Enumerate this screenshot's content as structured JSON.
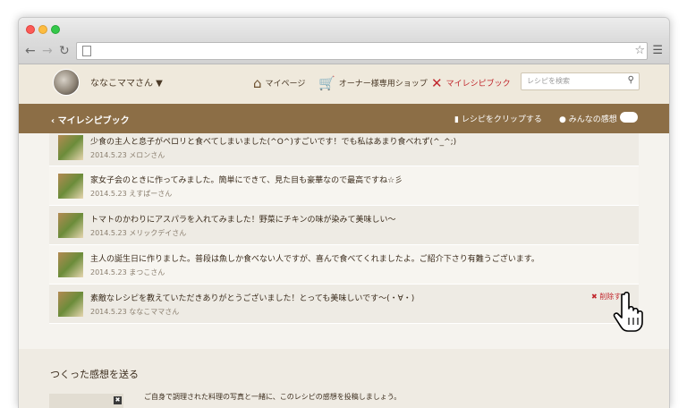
{
  "browser": {
    "nav_back": "←",
    "nav_forward": "→",
    "reload": "↻",
    "star": "☆",
    "menu": "☰"
  },
  "header": {
    "username": "ななこママさん ▼",
    "nav": [
      {
        "label": "マイページ",
        "icon": "house-icon"
      },
      {
        "label": "オーナー様専用ショップ",
        "icon": "cart-icon"
      },
      {
        "label": "マイレシピブック",
        "icon": "fork-knife-icon"
      }
    ],
    "search_placeholder": "レシピを検索",
    "accent_color": "#c1272d"
  },
  "subbar": {
    "back_label": "マイレシピブック",
    "clip_label": "レシピをクリップする",
    "kansou_label": "みんなの感想",
    "bg_color": "#8c6e46"
  },
  "comments": [
    {
      "text": "少食の主人と息子がペロリと食べてしまいました(^O^)すごいです！でも私はあまり食べれず(^_^;)",
      "meta": "2014.5.23 メロンさん"
    },
    {
      "text": "家女子会のときに作ってみました。簡単にできて、見た目も豪華なので最高ですね☆彡",
      "meta": "2014.5.23 えすぱーさん"
    },
    {
      "text": "トマトのかわりにアスパラを入れてみました！野菜にチキンの味が染みて美味しい〜",
      "meta": "2014.5.23 メリックデイさん"
    },
    {
      "text": "主人の誕生日に作りました。普段は魚しか食べない人ですが、喜んで食べてくれましたよ。ご紹介下さり有難うございます。",
      "meta": "2014.5.23 まつこさん"
    },
    {
      "text": "素敵なレシピを教えていただきありがとうございました！とっても美味しいです〜(・∀・)",
      "meta": "2014.5.23 ななこママさん",
      "delete_label": "削除す"
    }
  ],
  "footer": {
    "title": "つくった感想を送る",
    "hint": "ご自身で調理された料理の写真と一緒に、このレシピの感想を投稿しましょう。",
    "close": "✖"
  }
}
